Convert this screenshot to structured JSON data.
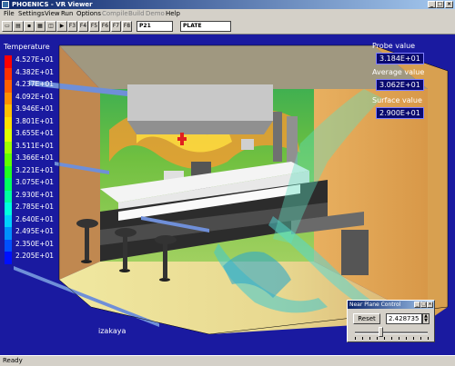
{
  "window": {
    "title": "PHOENICS - VR Viewer",
    "min": "_",
    "max": "□",
    "close": "×"
  },
  "menu": [
    {
      "label": "File",
      "enabled": true
    },
    {
      "label": "Settings",
      "enabled": true
    },
    {
      "label": "View",
      "enabled": true
    },
    {
      "label": "Run",
      "enabled": true
    },
    {
      "label": "Options",
      "enabled": true
    },
    {
      "label": "Compile",
      "enabled": false
    },
    {
      "label": "Build",
      "enabled": false
    },
    {
      "label": "Demo",
      "enabled": false
    },
    {
      "label": "Help",
      "enabled": true
    }
  ],
  "toolbar": {
    "fkeys": [
      "F3",
      "F4",
      "F5",
      "F6",
      "F7",
      "F8"
    ],
    "variable": "P21",
    "object": "PLATE"
  },
  "legend": {
    "title": "Temperature",
    "levels": [
      "4.527E+01",
      "4.382E+01",
      "4.237E+01",
      "4.092E+01",
      "3.946E+01",
      "3.801E+01",
      "3.655E+01",
      "3.511E+01",
      "3.366E+01",
      "3.221E+01",
      "3.075E+01",
      "2.930E+01",
      "2.785E+01",
      "2.640E+01",
      "2.495E+01",
      "2.350E+01",
      "2.205E+01"
    ],
    "colors": [
      "#ff0000",
      "#ff3000",
      "#ff6000",
      "#ff9000",
      "#ffc000",
      "#ffe000",
      "#e0ff00",
      "#a0ff00",
      "#60ff00",
      "#20ff20",
      "#00ff60",
      "#00ffa0",
      "#00ffe0",
      "#00d0ff",
      "#0090ff",
      "#0050ff",
      "#0010ff"
    ]
  },
  "probe": {
    "probe_label": "Probe value",
    "probe_value": "3.184E+01",
    "avg_label": "Average value",
    "avg_value": "3.062E+01",
    "surf_label": "Surface value",
    "surf_value": "2.900E+01"
  },
  "scene": {
    "caption": "izakaya"
  },
  "dialog": {
    "title": "Near Plane Control",
    "reset_label": "Reset",
    "value": "2.428735",
    "slider_position": 0.35
  },
  "status": {
    "text": "Ready"
  }
}
